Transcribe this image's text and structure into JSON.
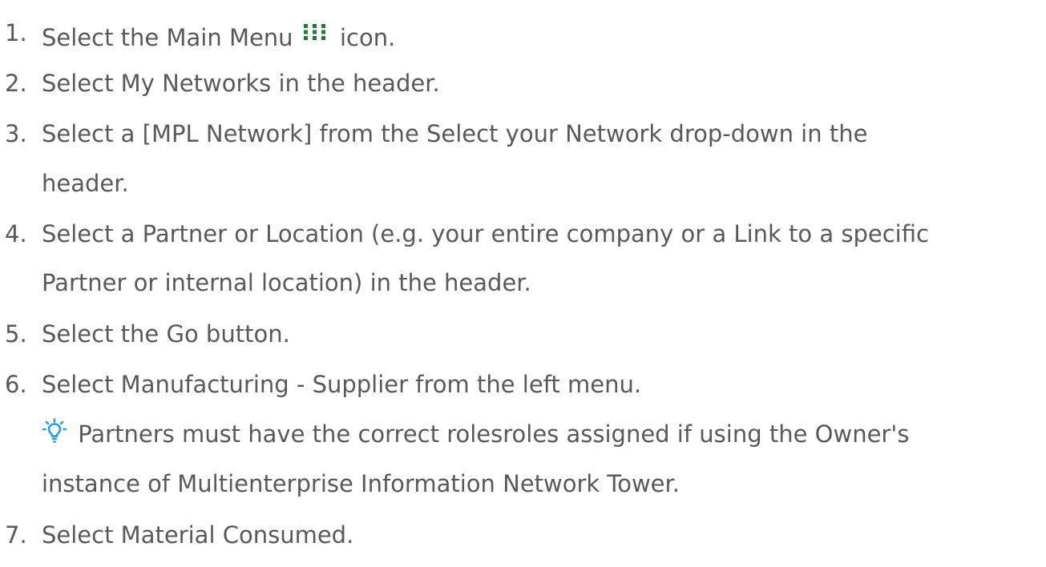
{
  "steps": [
    {
      "number": "1.",
      "before": "Select the Main Menu",
      "icon": "grid-dots-icon",
      "after": "icon."
    },
    {
      "number": "2.",
      "text": "Select My Networks in the header."
    },
    {
      "number": "3.",
      "line1": "Select a [MPL Network] from the Select your Network drop-down in the",
      "line2": "header."
    },
    {
      "number": "4.",
      "line1": "Select a Partner or Location (e.g. your entire company or a Link to a specific",
      "line2": "Partner or internal location) in the header."
    },
    {
      "number": "5.",
      "text": "Select the Go button."
    },
    {
      "number": "6.",
      "text": " Select Manufacturing - Supplier from the left menu."
    },
    {
      "number": "7.",
      "text": "Select Material Consumed."
    }
  ],
  "tip": {
    "icon": "lightbulb-icon",
    "line1": "Partners must have the correct rolesroles assigned if using the Owner's",
    "line2": "instance of Multienterprise Information Network Tower."
  },
  "colors": {
    "text": "#595959",
    "menu_icon": "#1f7a3a",
    "tip_icon": "#2a9fd8"
  }
}
